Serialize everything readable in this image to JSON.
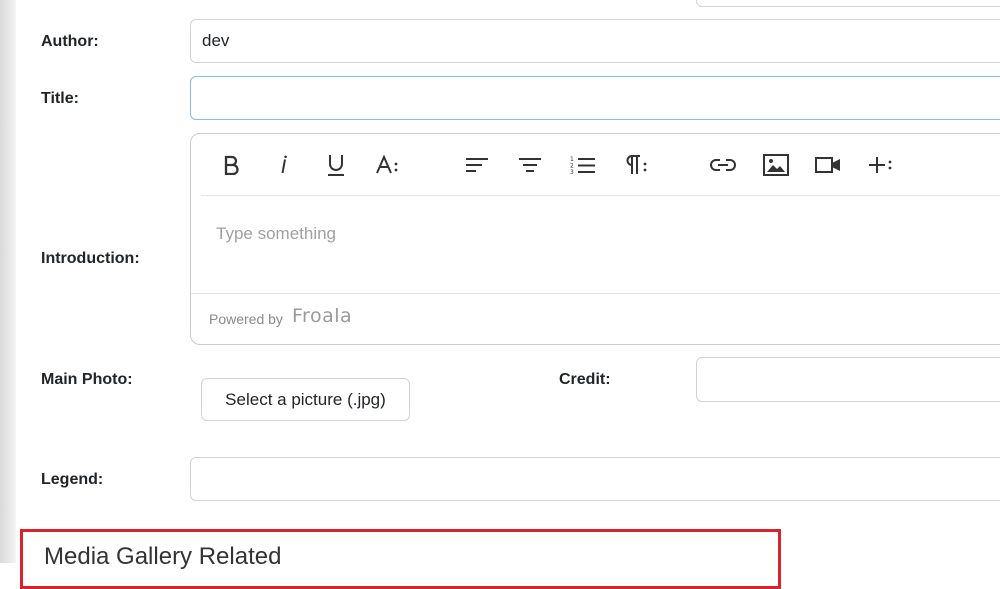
{
  "form": {
    "author_label": "Author:",
    "author_value": "dev",
    "title_label": "Title:",
    "title_value": "",
    "introduction_label": "Introduction:",
    "main_photo_label": "Main Photo:",
    "select_picture_label": "Select a picture (.jpg)",
    "credit_label": "Credit:",
    "credit_value": "",
    "legend_label": "Legend:",
    "legend_value": ""
  },
  "editor": {
    "placeholder": "Type something",
    "powered_by": "Powered by",
    "brand": "Froala",
    "toolbar": [
      {
        "name": "bold",
        "icon": "bold-icon"
      },
      {
        "name": "italic",
        "icon": "italic-icon"
      },
      {
        "name": "underline",
        "icon": "underline-icon"
      },
      {
        "name": "font-size",
        "icon": "text-size-icon"
      },
      {
        "name": "align-left",
        "icon": "align-left-icon"
      },
      {
        "name": "align-center",
        "icon": "align-center-icon"
      },
      {
        "name": "ordered-list",
        "icon": "ordered-list-icon"
      },
      {
        "name": "paragraph",
        "icon": "paragraph-icon"
      },
      {
        "name": "insert-link",
        "icon": "link-icon"
      },
      {
        "name": "insert-image",
        "icon": "image-icon"
      },
      {
        "name": "insert-video",
        "icon": "video-icon"
      },
      {
        "name": "more",
        "icon": "plus-more-icon"
      }
    ]
  },
  "media_section": {
    "title": "Media Gallery Related",
    "highlight_color": "#d9232d"
  }
}
